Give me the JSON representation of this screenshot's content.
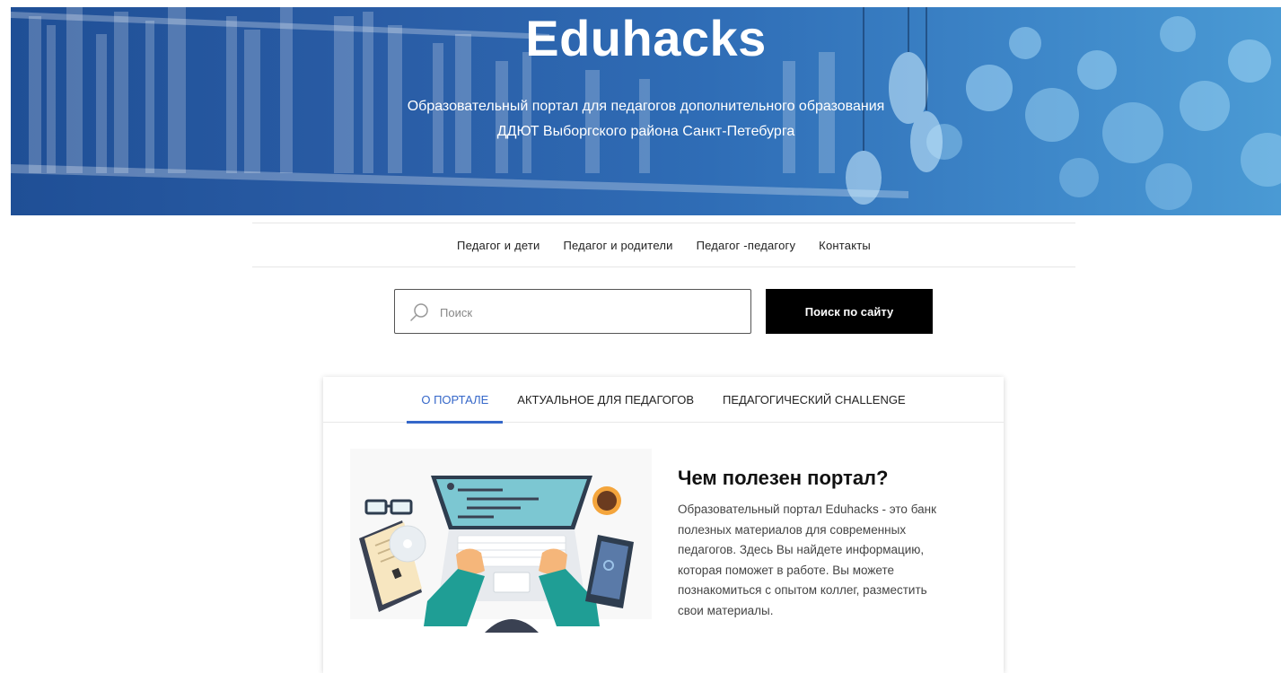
{
  "hero": {
    "title": "Eduhacks",
    "subtitle_line1": "Образовательный портал для педагогов дополнительного образования",
    "subtitle_line2": "ДДЮТ Выборгского района Санкт-Петебурга"
  },
  "nav": {
    "items": [
      {
        "label": "Педагог и дети"
      },
      {
        "label": "Педагог и родители"
      },
      {
        "label": "Педагог -педагогу"
      },
      {
        "label": "Контакты"
      }
    ]
  },
  "search": {
    "placeholder": "Поиск",
    "value": "",
    "button_label": "Поиск по сайту",
    "icon": "search-icon"
  },
  "tabs": {
    "items": [
      {
        "label": "О ПОРТАЛЕ",
        "active": true
      },
      {
        "label": "АКТУАЛЬНОЕ ДЛЯ ПЕДАГОГОВ",
        "active": false
      },
      {
        "label": "ПЕДАГОГИЧЕСКИЙ CHALLENGE",
        "active": false
      }
    ]
  },
  "about": {
    "title": "Чем полезен портал?",
    "text": "Образовательный портал Eduhacks - это банк полезных материалов для современных педагогов. Здесь Вы найдете информацию, которая поможет в работе. Вы можете познакомиться с опытом коллег, разместить свои материалы."
  },
  "colors": {
    "accent": "#3567c9",
    "button_bg": "#000000",
    "hero_blue": "#2a5da6"
  }
}
